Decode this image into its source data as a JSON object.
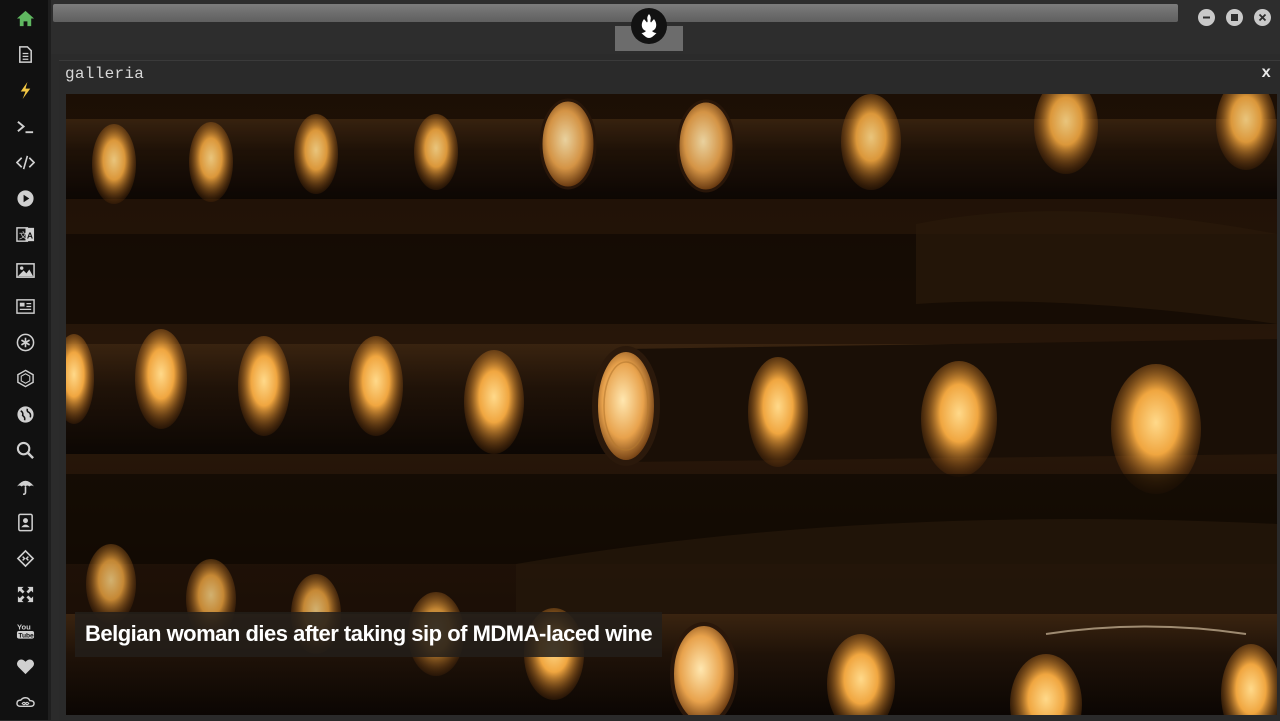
{
  "sidebar": {
    "items": [
      {
        "icon": "home-icon",
        "color": "#5fb760"
      },
      {
        "icon": "document-icon",
        "color": "#d0d0d0"
      },
      {
        "icon": "lightning-icon",
        "color": "#f2c744"
      },
      {
        "icon": "terminal-icon",
        "color": "#d0d0d0"
      },
      {
        "icon": "code-icon",
        "color": "#d0d0d0"
      },
      {
        "icon": "play-icon",
        "color": "#d0d0d0"
      },
      {
        "icon": "translate-icon",
        "color": "#d0d0d0"
      },
      {
        "icon": "image-icon",
        "color": "#d0d0d0"
      },
      {
        "icon": "newspaper-icon",
        "color": "#d0d0d0"
      },
      {
        "icon": "asterisk-icon",
        "color": "#d0d0d0"
      },
      {
        "icon": "hexagon-icon",
        "color": "#d0d0d0"
      },
      {
        "icon": "globe-icon",
        "color": "#d0d0d0"
      },
      {
        "icon": "search-icon",
        "color": "#d0d0d0"
      },
      {
        "icon": "umbrella-icon",
        "color": "#d0d0d0"
      },
      {
        "icon": "contacts-icon",
        "color": "#d0d0d0"
      },
      {
        "icon": "diamond-code-icon",
        "color": "#d0d0d0"
      },
      {
        "icon": "expand-icon",
        "color": "#d0d0d0"
      },
      {
        "icon": "youtube-icon",
        "color": "#d0d0d0"
      },
      {
        "icon": "heart-icon",
        "color": "#d0d0d0"
      },
      {
        "icon": "infinity-cloud-icon",
        "color": "#d0d0d0"
      }
    ]
  },
  "topbar": {
    "logo_icon": "rebel-alliance-icon",
    "window_buttons": [
      "minimize-icon",
      "maximize-icon",
      "close-icon"
    ]
  },
  "window": {
    "title": "galleria",
    "close_label": "x",
    "caption": "Belgian woman dies after taking sip of MDMA-laced wine"
  },
  "colors": {
    "background": "#2b2b2b",
    "sidebar": "#111111",
    "accent_green": "#5fb760",
    "accent_yellow": "#f2c744"
  }
}
